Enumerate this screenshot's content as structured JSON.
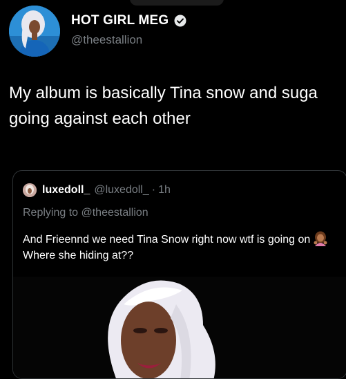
{
  "author": {
    "display_name": "HOT GIRL MEG",
    "handle": "@theestallion",
    "verified_icon": "verified-badge-icon"
  },
  "tweet": {
    "text": "My album is basically Tina snow and suga going against each other"
  },
  "quote": {
    "display_name": "luxedoll_",
    "handle": "@luxedoll_",
    "separator": "·",
    "age": "1h",
    "replying_to": "Replying to @theestallion",
    "body_before": "And Frieennd we need Tina Snow right now wtf is going on",
    "emoji_icon": "woman-gesturing-emoji-icon",
    "body_after": "Where she hiding at??"
  },
  "colors": {
    "background": "#000000",
    "text_primary": "#ffffff",
    "text_secondary": "#7a7f84",
    "border": "#2f3336"
  }
}
